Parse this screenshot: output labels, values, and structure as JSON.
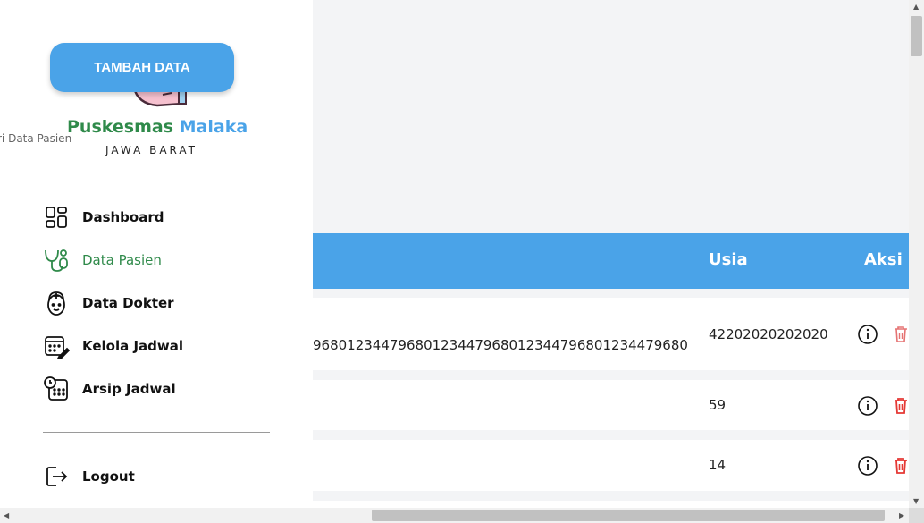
{
  "sidebar": {
    "add_button": "TAMBAH DATA",
    "brand_first": "Puskesmas",
    "brand_second": "Malaka",
    "region": "JAWA BARAT",
    "overlay_text": "ri Data Pasien",
    "nav": [
      {
        "label": "Dashboard",
        "icon": "dashboard-icon",
        "active": false
      },
      {
        "label": "Data Pasien",
        "icon": "stethoscope-icon",
        "active": true
      },
      {
        "label": "Data Dokter",
        "icon": "doctor-icon",
        "active": false
      },
      {
        "label": "Kelola Jadwal",
        "icon": "calendar-edit-icon",
        "active": false
      },
      {
        "label": "Arsip Jadwal",
        "icon": "schedule-archive-icon",
        "active": false
      }
    ],
    "logout": "Logout"
  },
  "table": {
    "headers": {
      "usia": "Usia",
      "aksi": "Aksi"
    },
    "rows": [
      {
        "id_text": "96801234479680123447968012344796801234479680",
        "usia": "42202020202020"
      },
      {
        "id_text": "",
        "usia": "59"
      },
      {
        "id_text": "",
        "usia": "14"
      }
    ]
  },
  "colors": {
    "accent": "#4aa3e8",
    "brand_green": "#2f8a4a",
    "delete": "#e53935"
  }
}
